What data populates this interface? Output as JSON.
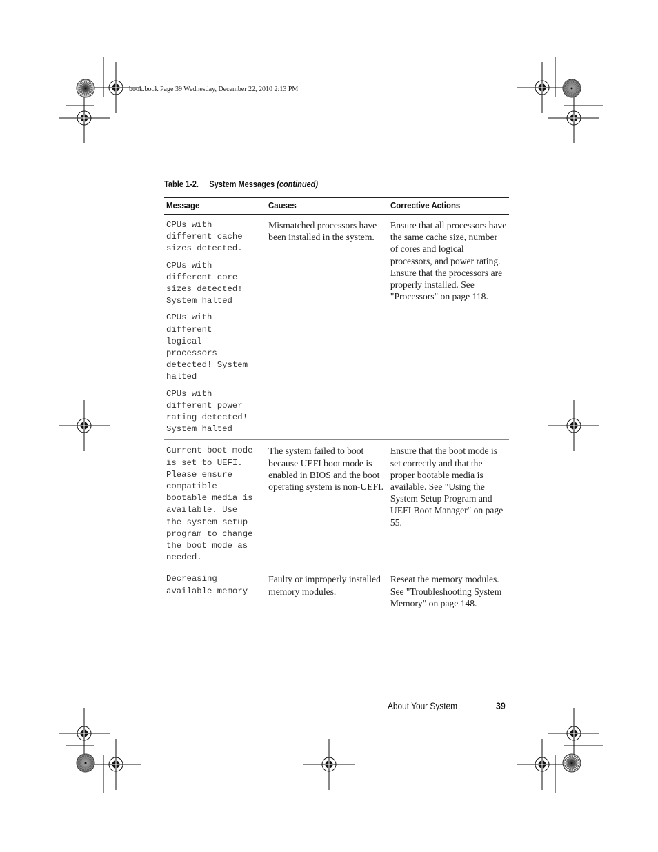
{
  "slug_line": "book.book  Page 39  Wednesday, December 22, 2010  2:13 PM",
  "table": {
    "caption_number": "Table 1-2.",
    "caption_title": "System Messages",
    "caption_suffix": "(continued)",
    "headers": [
      "Message",
      "Causes",
      "Corrective Actions"
    ],
    "rows": [
      {
        "messages": [
          "CPUs with\ndifferent cache\nsizes detected.",
          "CPUs with\ndifferent core\nsizes detected!\nSystem halted",
          "CPUs with\ndifferent\nlogical\nprocessors\ndetected! System\nhalted",
          "CPUs with\ndifferent power\nrating detected!\nSystem halted"
        ],
        "causes": "Mismatched processors have been installed in the system.",
        "actions": "Ensure that all processors have the same cache size, number of cores and logical processors, and power rating. Ensure that the processors are properly installed. See \"Processors\" on page 118."
      },
      {
        "messages": [
          "Current boot mode\nis set to UEFI.\nPlease ensure\ncompatible\nbootable media is\navailable. Use\nthe system setup\nprogram to change\nthe boot mode as\nneeded."
        ],
        "causes": "The system failed to boot because UEFI boot mode is enabled in BIOS and the boot operating system is non-UEFI.",
        "actions": "Ensure that the boot mode is set correctly and that the proper bootable media is available. See \"Using the System Setup Program and UEFI Boot Manager\" on page 55."
      },
      {
        "messages": [
          "Decreasing\navailable memory"
        ],
        "causes": "Faulty or improperly installed memory modules.",
        "actions": "Reseat the memory modules. See \"Troubleshooting System Memory\" on page 148."
      }
    ]
  },
  "footer": {
    "section_title": "About Your System",
    "page_number": "39"
  },
  "icons": {
    "registration_mark": "crosshair-registration-icon",
    "color_wheel": "starburst-print-target-icon"
  }
}
